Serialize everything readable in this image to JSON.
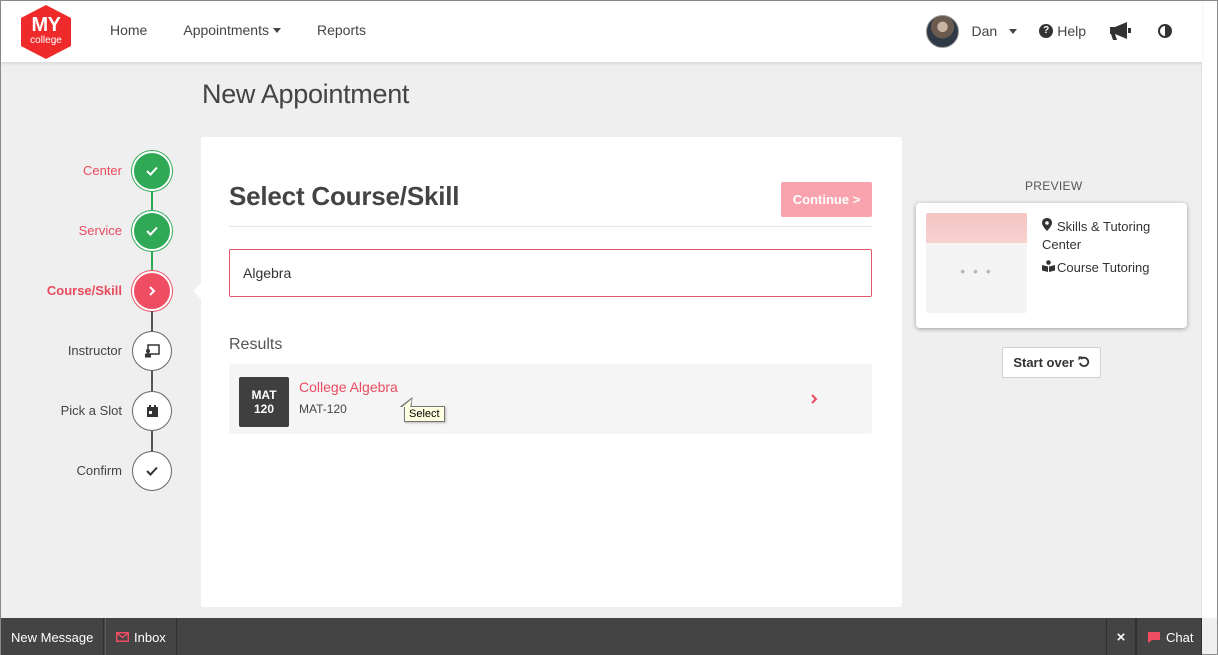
{
  "header": {
    "logo": {
      "text_main": "MY",
      "text_sub": "college"
    },
    "nav": {
      "home": "Home",
      "appointments": "Appointments",
      "reports": "Reports"
    },
    "user_name": "Dan",
    "help": "Help"
  },
  "page_title": "New Appointment",
  "steps": [
    {
      "label": "Center",
      "state": "done"
    },
    {
      "label": "Service",
      "state": "done"
    },
    {
      "label": "Course/Skill",
      "state": "active"
    },
    {
      "label": "Instructor",
      "state": "pending"
    },
    {
      "label": "Pick a Slot",
      "state": "pending"
    },
    {
      "label": "Confirm",
      "state": "pending"
    }
  ],
  "card": {
    "title": "Select Course/Skill",
    "continue_label": "Continue >",
    "search_value": "Algebra",
    "results_label": "Results",
    "results": [
      {
        "badge_line1": "MAT",
        "badge_line2": "120",
        "name": "College Algebra",
        "code": "MAT-120"
      }
    ],
    "tooltip": "Select"
  },
  "preview": {
    "label": "PREVIEW",
    "center": "Skills & Tutoring Center",
    "service": "Course Tutoring",
    "placeholder_dots": "• • •",
    "start_over_label": "Start over"
  },
  "bottom_bar": {
    "new_message": "New Message",
    "inbox": "Inbox",
    "chat": "Chat"
  },
  "colors": {
    "accent": "#ef4d62",
    "success": "#2fa955",
    "continue_disabled": "#f8a3ae",
    "bottom_bar": "#444444"
  }
}
